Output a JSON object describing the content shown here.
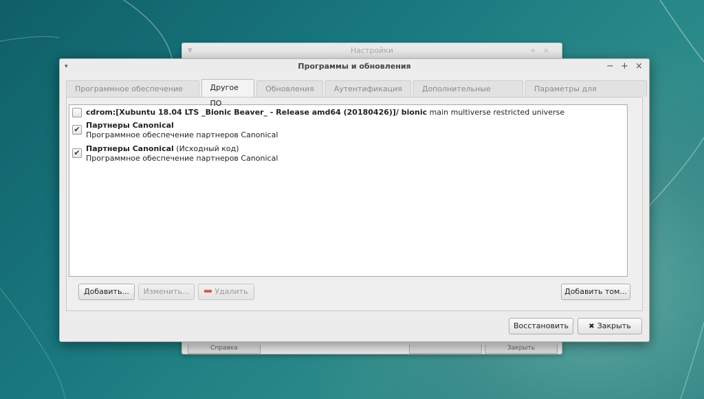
{
  "background_window": {
    "title": "Настройки",
    "help_label": "Справка",
    "close_label": "Закрыть"
  },
  "window": {
    "title": "Программы и обновления",
    "controls": {
      "menu": "▾",
      "minimize": "−",
      "maximize": "+",
      "close": "×"
    }
  },
  "tabs": [
    {
      "label": "Программное обеспечение Ubuntu",
      "active": false
    },
    {
      "label": "Другое ПО",
      "active": true
    },
    {
      "label": "Обновления",
      "active": false
    },
    {
      "label": "Аутентификация",
      "active": false
    },
    {
      "label": "Дополнительные драйверы",
      "active": false
    },
    {
      "label": "Параметры для разработчиков",
      "active": false
    }
  ],
  "sources": [
    {
      "checked": false,
      "title_bold": "cdrom:[Xubuntu 18.04 LTS _Bionic Beaver_ - Release amd64 (20180426)]/ bionic",
      "title_rest": " main multiverse restricted universe",
      "subtitle": ""
    },
    {
      "checked": true,
      "title_bold": "Партнеры Canonical",
      "title_rest": "",
      "subtitle": "Программное обеспечение партнеров Canonical"
    },
    {
      "checked": true,
      "title_bold": "Партнеры Canonical",
      "title_rest": " (Исходный код)",
      "subtitle": "Программное обеспечение партнеров Canonical"
    }
  ],
  "buttons": {
    "add": "Добавить...",
    "edit": "Изменить...",
    "remove": "Удалить",
    "add_volume": "Добавить том...",
    "revert": "Восстановить",
    "close": "Закрыть"
  },
  "icons": {
    "checkmark": "✔",
    "close_x": "✖"
  }
}
